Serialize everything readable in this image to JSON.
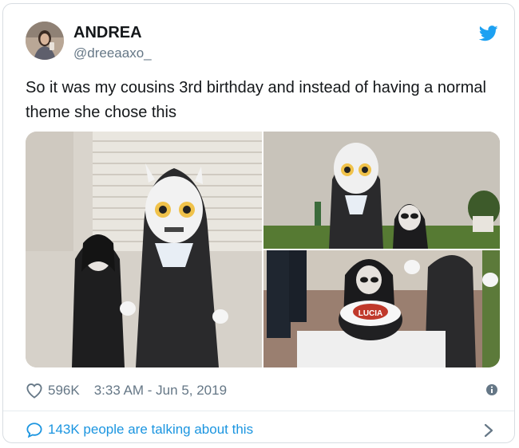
{
  "tweet": {
    "author_name": "ANDREA",
    "author_handle": "@dreeaaxo_",
    "text": "So it was my cousins 3rd birthday and instead of having a normal theme she chose this",
    "likes": "596K",
    "timestamp": "3:33 AM - Jun 5, 2019",
    "talking": "143K people are talking about this",
    "cake_text": "LUCIA"
  },
  "colors": {
    "brand_blue": "#1da1f2",
    "link_blue": "#1b95e0",
    "muted_gray": "#657786"
  },
  "icons": {
    "logo": "twitter-bird-icon",
    "like": "heart-icon",
    "info": "info-icon",
    "reply": "speech-bubble-icon",
    "more": "chevron-right-icon"
  }
}
